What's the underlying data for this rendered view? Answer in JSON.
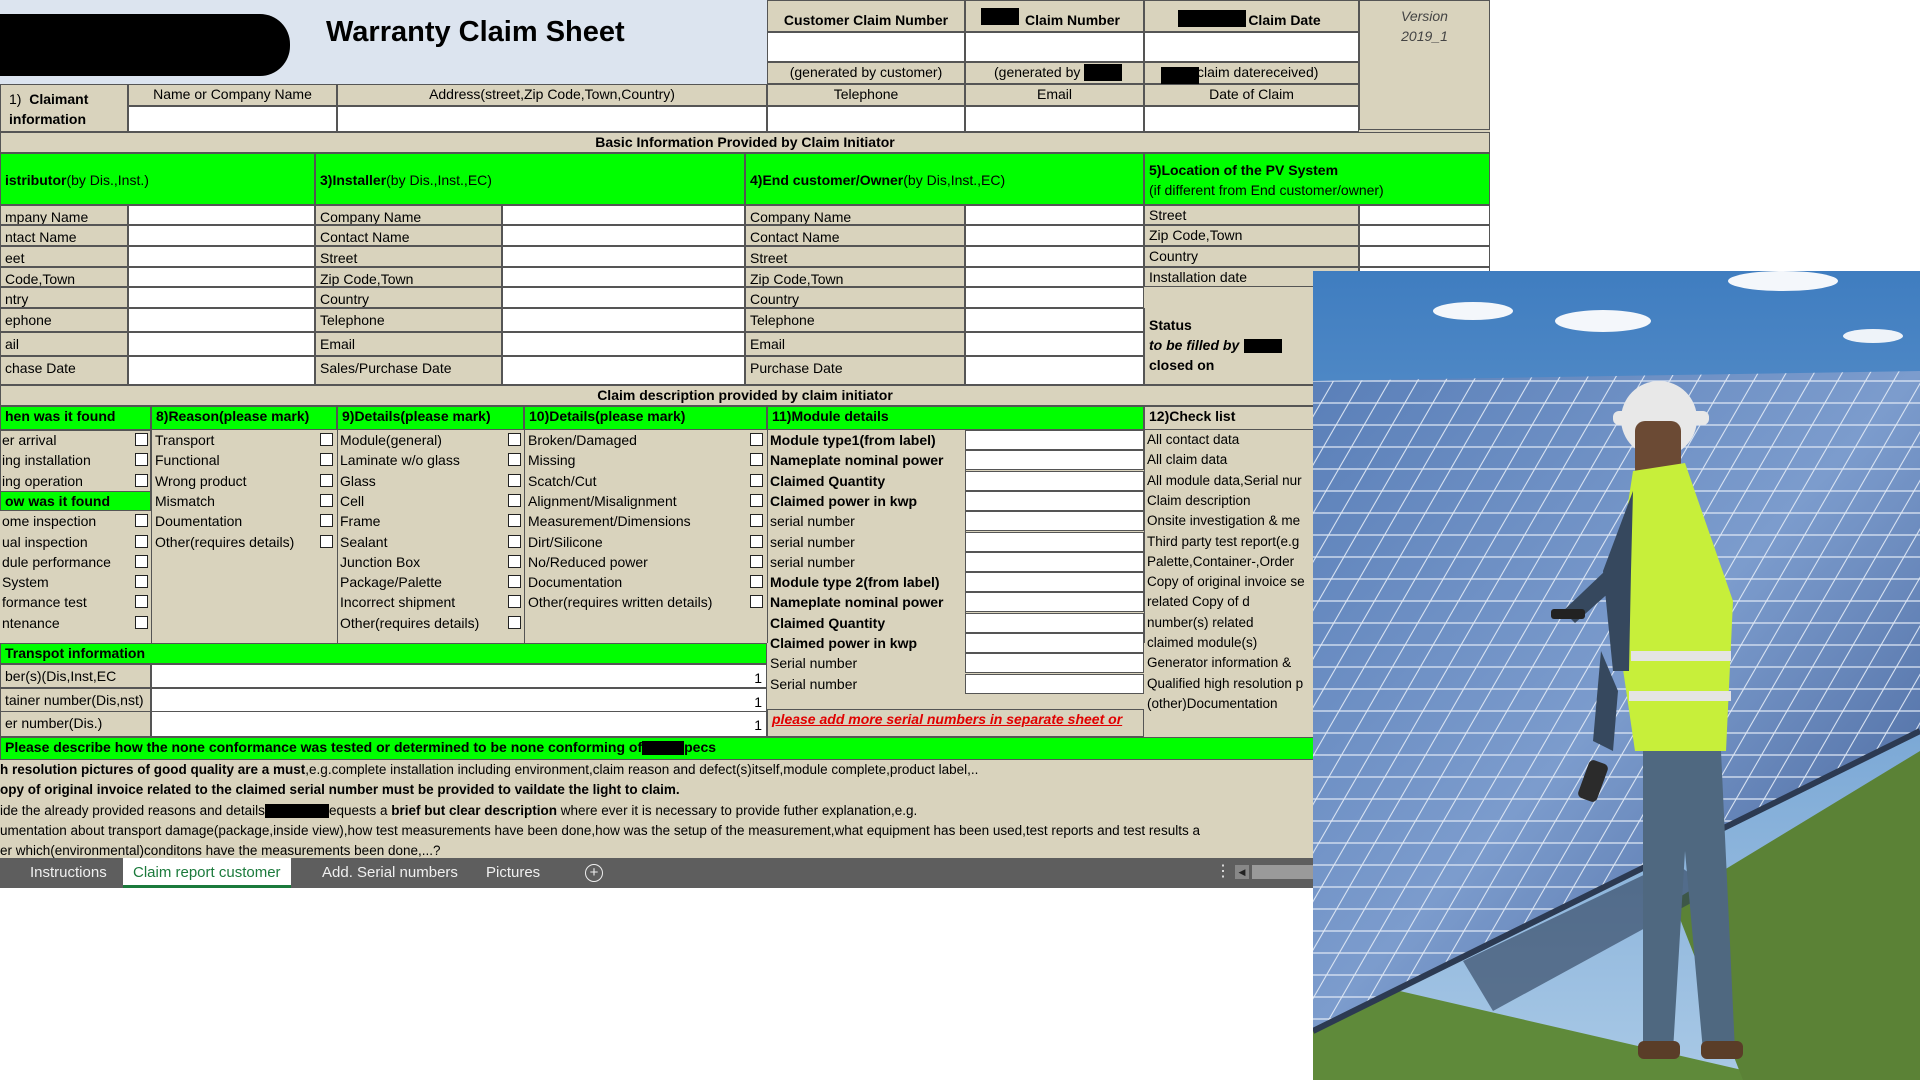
{
  "title": "Warranty Claim Sheet",
  "version": {
    "label": "Version",
    "value": "2019_1"
  },
  "top_fields": {
    "customer_claim_number": "Customer Claim Number",
    "claim_number": "Claim Number",
    "claim_date": "Claim Date",
    "gen_customer": "(generated by customer)",
    "gen_by": "(generated by",
    "claim_date_received": "claim datereceived)"
  },
  "claimant": {
    "label_num": "1)",
    "label_bold": "Claimant",
    "label2": "information",
    "cols": [
      "Name or Company Name",
      "Address(street,Zip Code,Town,Country)",
      "Telephone",
      "Email",
      "Date of Claim"
    ]
  },
  "basic_info_header": "Basic Information Provided by Claim Initiator",
  "sections": {
    "distributor": {
      "bold": "istributor",
      "rest": "(by Dis.,Inst.)"
    },
    "installer": {
      "bold": "3)Installer",
      "rest": "(by Dis.,Inst.,EC)"
    },
    "end_customer": {
      "bold": "4)End customer/Owner",
      "rest": "(by Dis,Inst.,EC)"
    },
    "location": {
      "line1": "5)Location of the PV System",
      "line2": "(if different from End customer/owner)"
    }
  },
  "distributor_rows": [
    "mpany Name",
    "ntact Name",
    "eet",
    "Code,Town",
    "ntry",
    "ephone",
    "ail",
    "chase Date"
  ],
  "installer_rows": [
    "Company Name",
    "Contact Name",
    "Street",
    "Zip Code,Town",
    "Country",
    "Telephone",
    "Email",
    "Sales/Purchase Date"
  ],
  "end_customer_rows": [
    "Company Name",
    "Contact Name",
    "Street",
    "Zip Code,Town",
    "Country",
    "Telephone",
    "Email",
    "Purchase Date"
  ],
  "location_rows": [
    "Street",
    "Zip Code,Town",
    "Country",
    "Installation date"
  ],
  "status": {
    "label": "Status",
    "filled_by": "to be filled by",
    "closed_on": "closed on"
  },
  "claim_desc_header": "Claim description provided by claim initiator",
  "when_found": {
    "header": "hen was it found",
    "items": [
      "er arrival",
      "ing installation",
      "ing operation"
    ]
  },
  "how_found": {
    "header": "ow was it found",
    "items": [
      "ome inspection",
      "ual inspection",
      "dule performance",
      "System",
      "formance test",
      "ntenance"
    ]
  },
  "reason": {
    "header": "8)Reason(please mark)",
    "items": [
      "Transport",
      "Functional",
      "Wrong product",
      "Mismatch",
      "Doumentation",
      "Other(requires details)"
    ]
  },
  "details9": {
    "header": "9)Details(please mark)",
    "items": [
      "Module(general)",
      "Laminate w/o glass",
      "Glass",
      "Cell",
      "Frame",
      "Sealant",
      "Junction Box",
      "Package/Palette",
      "Incorrect shipment",
      "Other(requires details)"
    ]
  },
  "details10": {
    "header": "10)Details(please mark)",
    "items": [
      "Broken/Damaged",
      "Missing",
      "Scatch/Cut",
      "Alignment/Misalignment",
      "Measurement/Dimensions",
      "Dirt/Silicone",
      "No/Reduced power",
      "Documentation",
      "Other(requires written details)"
    ]
  },
  "module_details": {
    "header": "11)Module details",
    "items": [
      "Module type1(from label)",
      "Nameplate nominal power",
      "Claimed Quantity",
      "Claimed power in kwp",
      "serial number",
      "serial number",
      "serial number",
      "Module type 2(from label)",
      "Nameplate nominal power",
      "Claimed Quantity",
      "Claimed power in kwp",
      "Serial number",
      "Serial number"
    ],
    "note": "please add more serial numbers in separate sheet or"
  },
  "checklist": {
    "header": "12)Check list",
    "items": [
      "All contact data",
      "All claim data",
      "All module data,Serial nur",
      "Claim description",
      "Onsite investigation & me",
      "Third party test report(e.g",
      "Palette,Container-,Order",
      "Copy of original invoice se",
      "related          Copy of d",
      "number(s) related",
      "claimed module(s)",
      "Generator information &",
      "Qualified high resolution p",
      "(other)Documentation"
    ]
  },
  "transport": {
    "header": "Transpot information",
    "rows": [
      "ber(s)(Dis,Inst,EC",
      "tainer number(Dis,nst)",
      "er number(Dis.)"
    ],
    "values": [
      "1",
      "1",
      "1"
    ]
  },
  "describe": {
    "text": "Please describe how the none conformance was tested or determined to be none conforming of",
    "suffix": "pecs"
  },
  "notes": [
    {
      "b": "h resolution pictures of good quality are a must",
      "t": ",e.g.complete installation including environment,claim reason and defect(s)itself,module complete,product label,.."
    },
    {
      "b": "opy of original invoice related to the claimed serial number must be provided to vaildate the light to claim.",
      "t": ""
    },
    {
      "t1": "ide the already provided reasons and details",
      "t2": "equests a ",
      "b": "brief but clear description",
      "t3": " where ever it is necessary to provide futher explanation,e.g."
    },
    {
      "t": "umentation about transport damage(package,inside view),how test measurements have been done,how was the setup of the measurement,what equipment has been used,test reports and test results a"
    },
    {
      "t": "er which(environmental)conditons have the measurements been done,...?"
    }
  ],
  "tabs": [
    "Instructions",
    "Claim report customer",
    "Add. Serial numbers",
    "Pictures"
  ],
  "add_tab_icon": "plus-circle-icon",
  "more_icon": "vertical-ellipsis-icon",
  "scroll_left_icon": "scroll-left-icon",
  "colors": {
    "green": "#00ff00",
    "sheet": "#d9d3bd",
    "header_blue": "#dce4ef",
    "tab_active": "#1b7a3c",
    "red_note": "#e00000"
  }
}
